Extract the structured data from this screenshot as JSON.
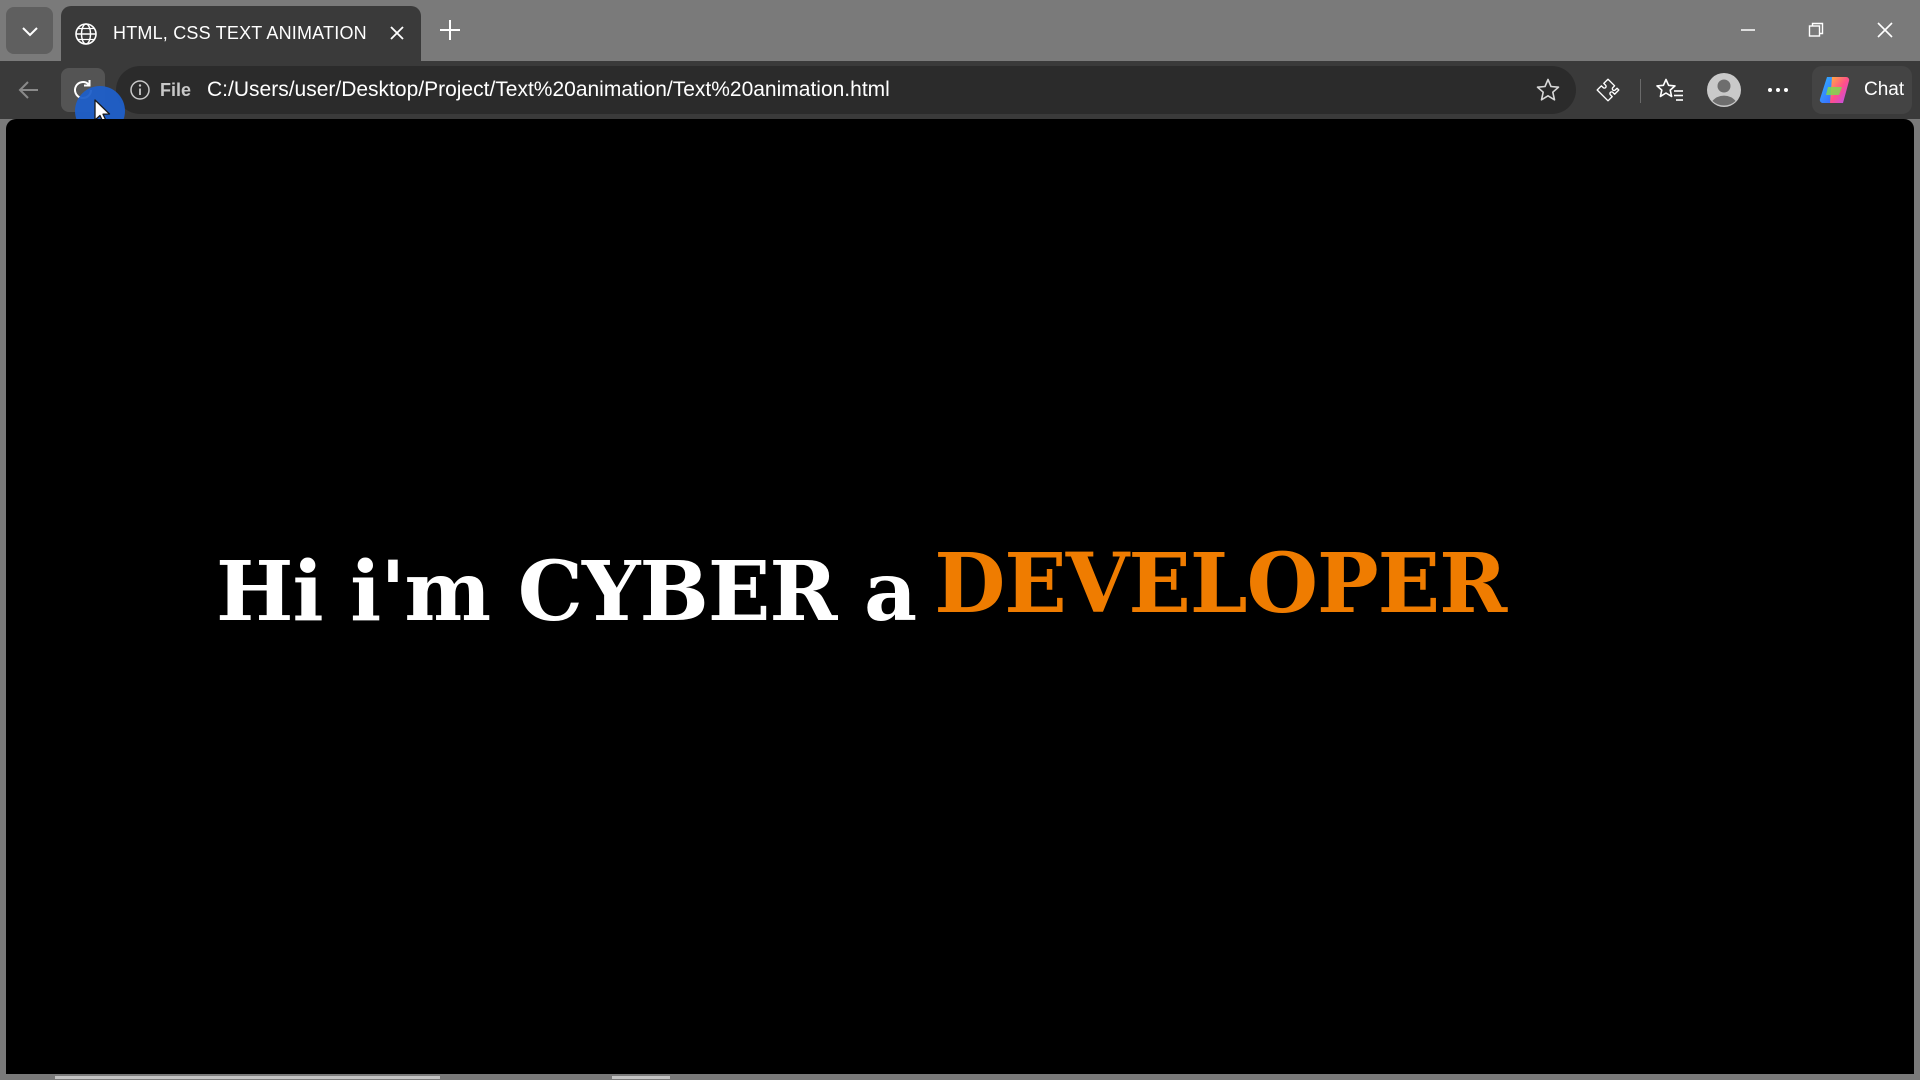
{
  "tab": {
    "title": "HTML, CSS TEXT ANIMATION",
    "favicon": "globe-icon"
  },
  "address_bar": {
    "scheme_label": "File",
    "url": "C:/Users/user/Desktop/Project/Text%20animation/Text%20animation.html"
  },
  "toolbar": {
    "chat_label": "Chat"
  },
  "page": {
    "headline_static": "Hi i'm CYBER a",
    "headline_animated": "DEVELOPER",
    "background_color": "#000000",
    "text_color": "#ffffff",
    "accent_color": "#ef7c00"
  },
  "icons": [
    "chevron-down-icon",
    "globe-icon",
    "close-icon",
    "plus-icon",
    "minimize-icon",
    "restore-icon",
    "back-arrow-icon",
    "refresh-icon",
    "info-icon",
    "star-icon",
    "extensions-icon",
    "favorites-icon",
    "profile-icon",
    "more-icon",
    "copilot-icon"
  ]
}
